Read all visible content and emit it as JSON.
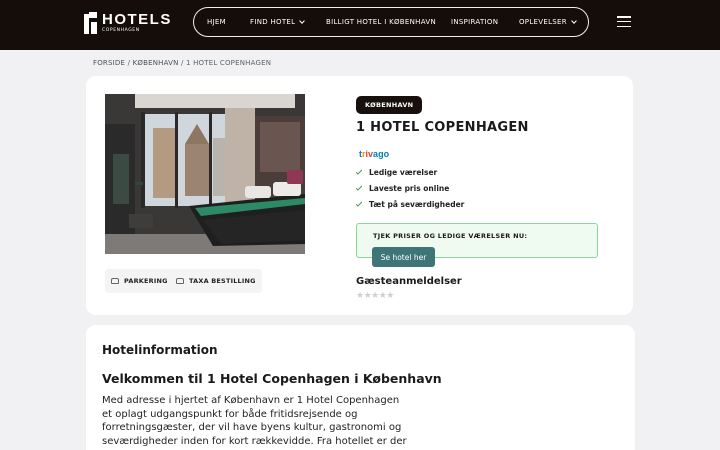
{
  "header": {
    "logo_text": "HOTELS",
    "logo_subtext": "COPENHAGEN",
    "nav": [
      {
        "label": "HJEM"
      },
      {
        "label": "FIND HOTEL"
      },
      {
        "label": "BILLIGT HOTEL I KØBENHAVN"
      },
      {
        "label": "INSPIRATION"
      },
      {
        "label": "OPLEVELSER"
      }
    ]
  },
  "breadcrumb": {
    "home": "FORSIDE",
    "city": "KØBENHAVN",
    "current": "1 HOTEL COPENHAGEN",
    "separator": "/"
  },
  "hotel": {
    "badge": "KØBENHAVN",
    "name": "1 HOTEL COPENHAGEN",
    "trivago_letters": [
      "t",
      "r",
      "i",
      "v",
      "a",
      "g",
      "o"
    ],
    "trivago_colors": [
      "#007fad",
      "#f48f00",
      "#c94a38",
      "#c94a38",
      "#007fad",
      "#007fad",
      "#007fad"
    ],
    "features": [
      "Ledige værelser",
      "Laveste pris online",
      "Tæt på seværdigheder"
    ],
    "price_label": "TJEK PRISER OG LEDIGE VÆRELSER NU:",
    "cta_label": "Se hotel her",
    "reviews_title": "Gæsteanmeldelser",
    "stars": "★★★★★",
    "amenities": [
      {
        "label": "PARKERING",
        "icon": "car-icon"
      },
      {
        "label": "TAXA BESTILLING",
        "icon": "taxi-icon"
      }
    ]
  },
  "info": {
    "title": "Hotelinformation",
    "welcome": "Velkommen til 1 Hotel Copenhagen i København",
    "description": "Med adresse i hjertet af København er 1 Hotel Copenhagen et oplagt udgangspunkt for både fritidsrejsende og forretningsgæster, der vil have byens kultur, gastronomi og seværdigheder inden for kort rækkevidde. Fra hotellet er der nem"
  },
  "colors": {
    "header_bg": "#150d0a",
    "page_bg": "#f1f1f3",
    "accent_button": "#3d7579",
    "check_green": "#3c9a5a",
    "price_box_border": "#8ad79b"
  }
}
